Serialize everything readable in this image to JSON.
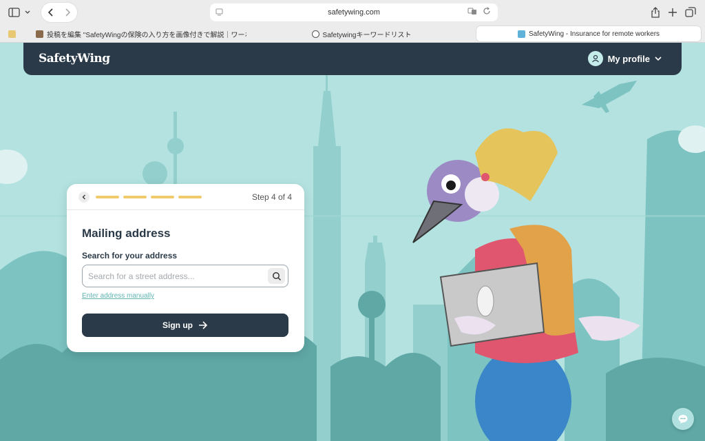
{
  "browser": {
    "url": "safetywing.com",
    "tabs": [
      {
        "title": "投稿を編集 \"SafetyWingの保険の入り方を画像付きで解説｜ワーホリで...",
        "active": false
      },
      {
        "title": "Safetywingキーワードリスト",
        "active": false
      },
      {
        "title": "SafetyWing - Insurance for remote workers",
        "active": true
      }
    ]
  },
  "navbar": {
    "logo": "SafetyWing",
    "profile_label": "My profile"
  },
  "form": {
    "step_text": "Step 4 of 4",
    "progress_steps": 4,
    "progress_completed": 4,
    "title": "Mailing address",
    "search_label": "Search for your address",
    "search_placeholder": "Search for a street address...",
    "manual_link": "Enter address manually",
    "submit_label": "Sign up"
  },
  "colors": {
    "navy": "#2b3a48",
    "teal_bg": "#b3e2e0",
    "progress": "#f0c96b",
    "link": "#5fb3b3"
  }
}
